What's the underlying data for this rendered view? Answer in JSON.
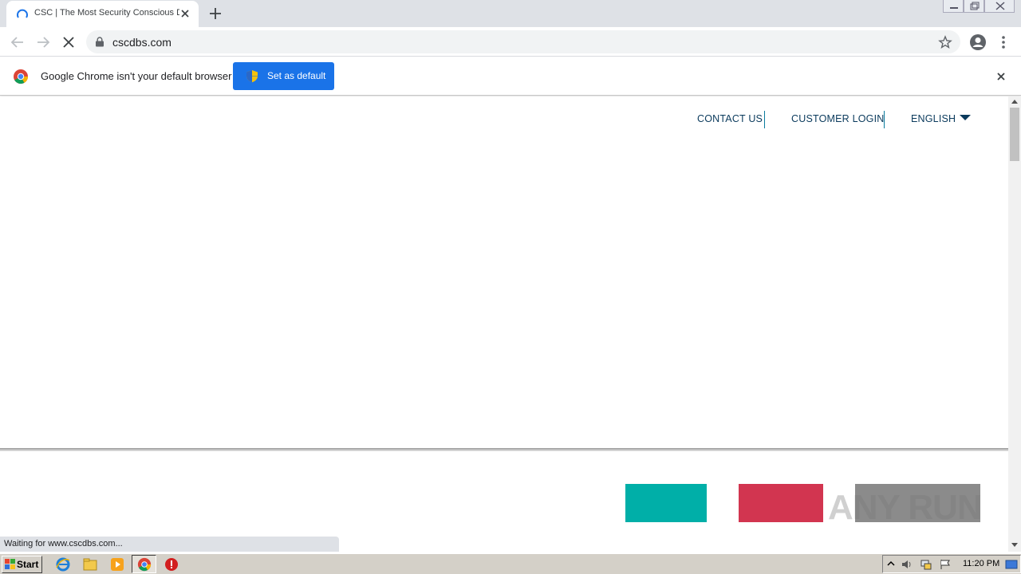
{
  "browser": {
    "tab": {
      "title": "CSC | The Most Security Conscious D"
    },
    "address": {
      "url": "cscdbs.com"
    }
  },
  "infobar": {
    "message": "Google Chrome isn't your default browser",
    "button_label": "Set as default"
  },
  "site": {
    "nav": {
      "contact": "CONTACT US",
      "login": "CUSTOMER LOGIN",
      "language": "ENGLISH"
    },
    "colors": {
      "teal": "#00afa8",
      "crimson": "#d23550",
      "gray": "#8b8b8b",
      "nav_text": "#0a3a5c"
    }
  },
  "status": {
    "text": "Waiting for www.cscdbs.com..."
  },
  "watermark": {
    "text": "ANY RUN"
  },
  "taskbar": {
    "start_label": "Start",
    "clock": "11:20 PM"
  }
}
